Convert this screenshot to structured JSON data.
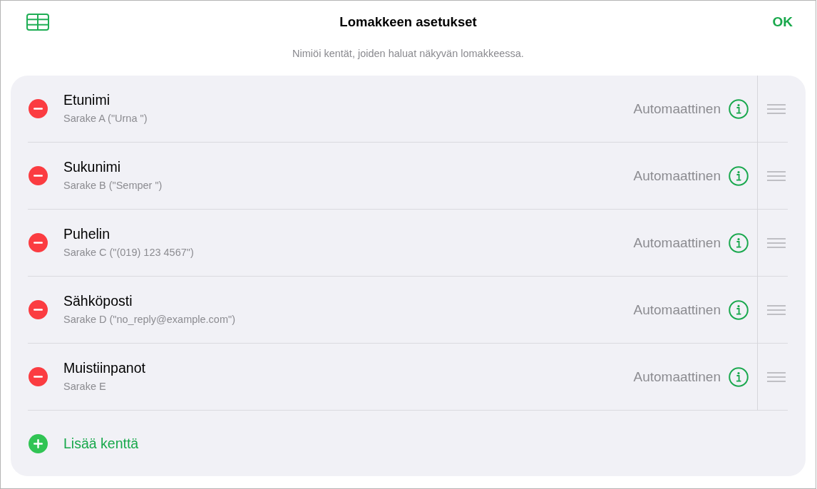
{
  "header": {
    "title": "Lomakkeen asetukset",
    "done_button": "OK",
    "subtitle": "Nimiöi kentät, joiden haluat näkyvän lomakkeessa."
  },
  "fields": [
    {
      "name": "Etunimi",
      "source": "Sarake A (\"Urna \")",
      "format": "Automaattinen"
    },
    {
      "name": "Sukunimi",
      "source": "Sarake B (\"Semper \")",
      "format": "Automaattinen"
    },
    {
      "name": "Puhelin",
      "source": "Sarake C (\"(019) 123 4567\")",
      "format": "Automaattinen"
    },
    {
      "name": "Sähköposti",
      "source": "Sarake D (\"no_reply@example.com\")",
      "format": "Automaattinen"
    },
    {
      "name": "Muistiinpanot",
      "source": "Sarake E",
      "format": "Automaattinen"
    }
  ],
  "add_field": {
    "label": "Lisää kenttä"
  }
}
